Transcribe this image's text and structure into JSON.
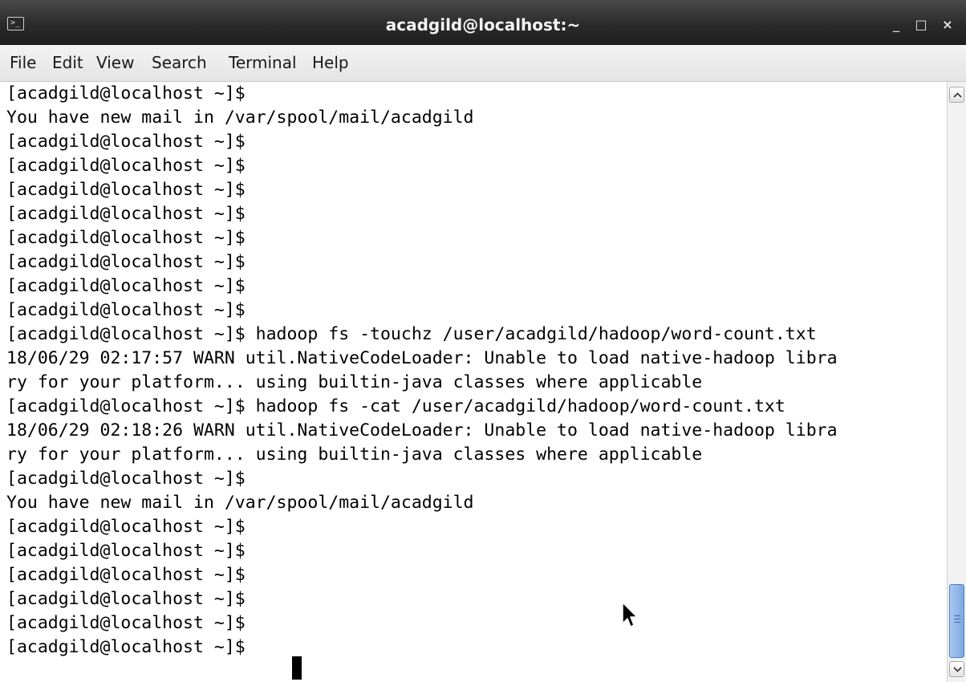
{
  "window": {
    "title": "acadgild@localhost:~",
    "controls": {
      "minimize": "_",
      "maximize": "□",
      "close": "×"
    }
  },
  "menu": [
    "File",
    "Edit",
    "View",
    "Search",
    "Terminal",
    "Help"
  ],
  "terminal": {
    "lines": [
      "[acadgild@localhost ~]$",
      "You have new mail in /var/spool/mail/acadgild",
      "[acadgild@localhost ~]$",
      "[acadgild@localhost ~]$",
      "[acadgild@localhost ~]$",
      "[acadgild@localhost ~]$",
      "[acadgild@localhost ~]$",
      "[acadgild@localhost ~]$",
      "[acadgild@localhost ~]$",
      "[acadgild@localhost ~]$",
      "[acadgild@localhost ~]$ hadoop fs -touchz /user/acadgild/hadoop/word-count.txt",
      "18/06/29 02:17:57 WARN util.NativeCodeLoader: Unable to load native-hadoop libra",
      "ry for your platform... using builtin-java classes where applicable",
      "[acadgild@localhost ~]$ hadoop fs -cat /user/acadgild/hadoop/word-count.txt",
      "18/06/29 02:18:26 WARN util.NativeCodeLoader: Unable to load native-hadoop libra",
      "ry for your platform... using builtin-java classes where applicable",
      "[acadgild@localhost ~]$",
      "You have new mail in /var/spool/mail/acadgild",
      "[acadgild@localhost ~]$",
      "[acadgild@localhost ~]$",
      "[acadgild@localhost ~]$",
      "[acadgild@localhost ~]$",
      "[acadgild@localhost ~]$",
      "[acadgild@localhost ~]$"
    ]
  },
  "icons": {
    "app": "terminal-icon",
    "scroll_up": "chevron-up-icon",
    "scroll_down": "chevron-down-icon",
    "pointer": "mouse-pointer-icon"
  },
  "colors": {
    "titlebar": "#2b2b2b",
    "menubar": "#ececec",
    "terminal_bg": "#ffffff",
    "terminal_fg": "#000000",
    "scroll_thumb": "#8fb4e6"
  }
}
